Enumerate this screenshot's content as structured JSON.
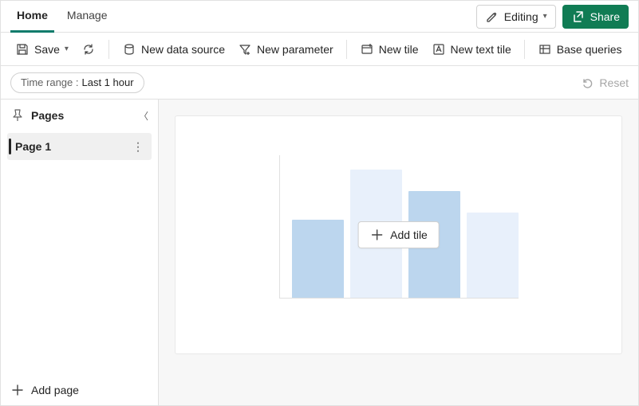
{
  "tabs": {
    "home": "Home",
    "manage": "Manage",
    "active": "home"
  },
  "header_actions": {
    "editing": "Editing",
    "share": "Share"
  },
  "toolbar": {
    "save": "Save",
    "new_data_source": "New data source",
    "new_parameter": "New parameter",
    "new_tile": "New tile",
    "new_text_tile": "New text tile",
    "base_queries": "Base queries"
  },
  "filter": {
    "prefix": "Time range :",
    "value": "Last 1 hour",
    "reset": "Reset"
  },
  "sidebar": {
    "title": "Pages",
    "pages": [
      {
        "label": "Page 1",
        "active": true
      }
    ],
    "add_page": "Add page"
  },
  "canvas": {
    "add_tile": "Add tile"
  }
}
